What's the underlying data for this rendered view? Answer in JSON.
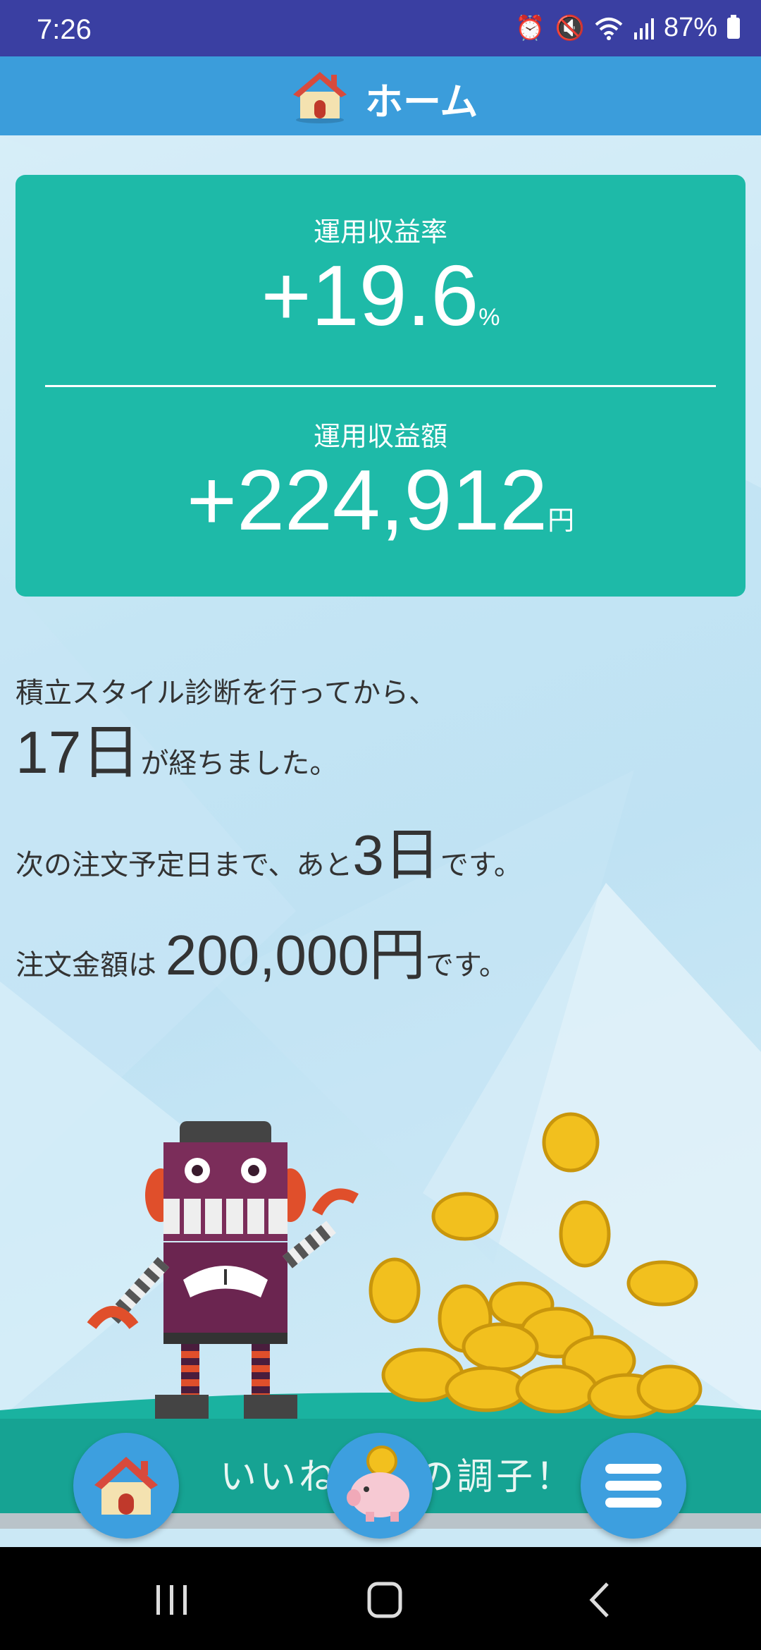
{
  "status_bar": {
    "time": "7:26",
    "battery": "87%"
  },
  "header": {
    "title": "ホーム"
  },
  "stats": {
    "rate_label": "運用収益率",
    "rate_value": "+19.6",
    "rate_unit": "%",
    "amount_label": "運用収益額",
    "amount_value": "+224,912",
    "amount_unit": "円"
  },
  "messages": {
    "line1": "積立スタイル診断を行ってから、",
    "days_elapsed": "17日",
    "line2_suffix": "が経ちました。",
    "line3_prefix": "次の注文予定日まで、あと",
    "days_remaining": "3日",
    "line3_suffix": "です。",
    "line4_prefix": "注文金額は",
    "order_amount": "200,000円",
    "line4_suffix": "です。"
  },
  "bottom": {
    "ticker": "いいね、この調子！"
  },
  "colors": {
    "header": "#3b9ddb",
    "card": "#1ebaa8",
    "bottom_bar": "#16a393",
    "status_bar": "#3a3fa2"
  },
  "icons": [
    "alarm-icon",
    "mute-icon",
    "wifi-icon",
    "signal-icon",
    "battery-icon",
    "house-icon",
    "piggy-bank-icon",
    "menu-icon"
  ]
}
